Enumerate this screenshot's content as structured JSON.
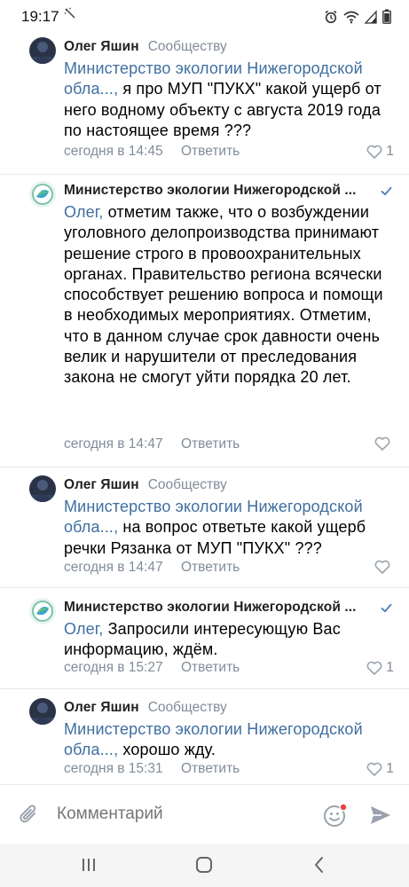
{
  "status_bar": {
    "time": "19:17",
    "extra_icon": "activity-icon",
    "icons": [
      "alarm-icon",
      "wifi-icon",
      "signal-icon",
      "battery-icon"
    ]
  },
  "comments": [
    {
      "author": "Олег Яшин",
      "context": "Сообществу",
      "mention": "Министерство экологии Нижегородской обла...,",
      "text_line1_rest": " я про МУП \"ПУКХ\" какой ущерб от",
      "text_rest": "него водному объекту с августа 2019 года по настоящее время ???",
      "time": "сегодня в 14:45",
      "reply": "Ответить",
      "likes": "1"
    },
    {
      "author": "Министерство экологии Нижегородской ...",
      "mention": "Олег,",
      "text_line1_rest": " отметим также, что о возбуждении",
      "text_rest": "уголовного делопроизводства принимают решение строго в провоохранительных органах. Правительство региона всячески способствует решению вопроса и помощи в необходимых мероприятиях. Отметим, что в данном случае срок давности очень велик и нарушители от преследования закона не смогут уйти порядка 20 лет.",
      "time": "сегодня в 14:47",
      "reply": "Ответить",
      "likes": ""
    },
    {
      "author": "Олег Яшин",
      "context": "Сообществу",
      "mention": "Министерство экологии Нижегородской обла...,",
      "text_line1_rest": " на вопрос ответьте какой ущерб",
      "text_rest": "речки Рязанка от МУП \"ПУКХ\" ???",
      "time": "сегодня в 14:47",
      "reply": "Ответить",
      "likes": ""
    },
    {
      "author": "Министерство экологии Нижегородской ...",
      "mention": "Олег,",
      "text_line1_rest": " Запросили интересующую Вас",
      "text_rest": "информацию, ждём.",
      "time": "сегодня в 15:27",
      "reply": "Ответить",
      "likes": "1"
    },
    {
      "author": "Олег Яшин",
      "context": "Сообществу",
      "mention": "Министерство экологии Нижегородской обла...,",
      "text_line1_rest": " хорошо жду.",
      "text_rest": "",
      "time": "сегодня в 15:31",
      "reply": "Ответить",
      "likes": "1"
    }
  ],
  "composer": {
    "placeholder": "Комментарий"
  },
  "colors": {
    "link": "#3f6fa0",
    "meta": "#818c99",
    "send": "#99a2ad"
  }
}
